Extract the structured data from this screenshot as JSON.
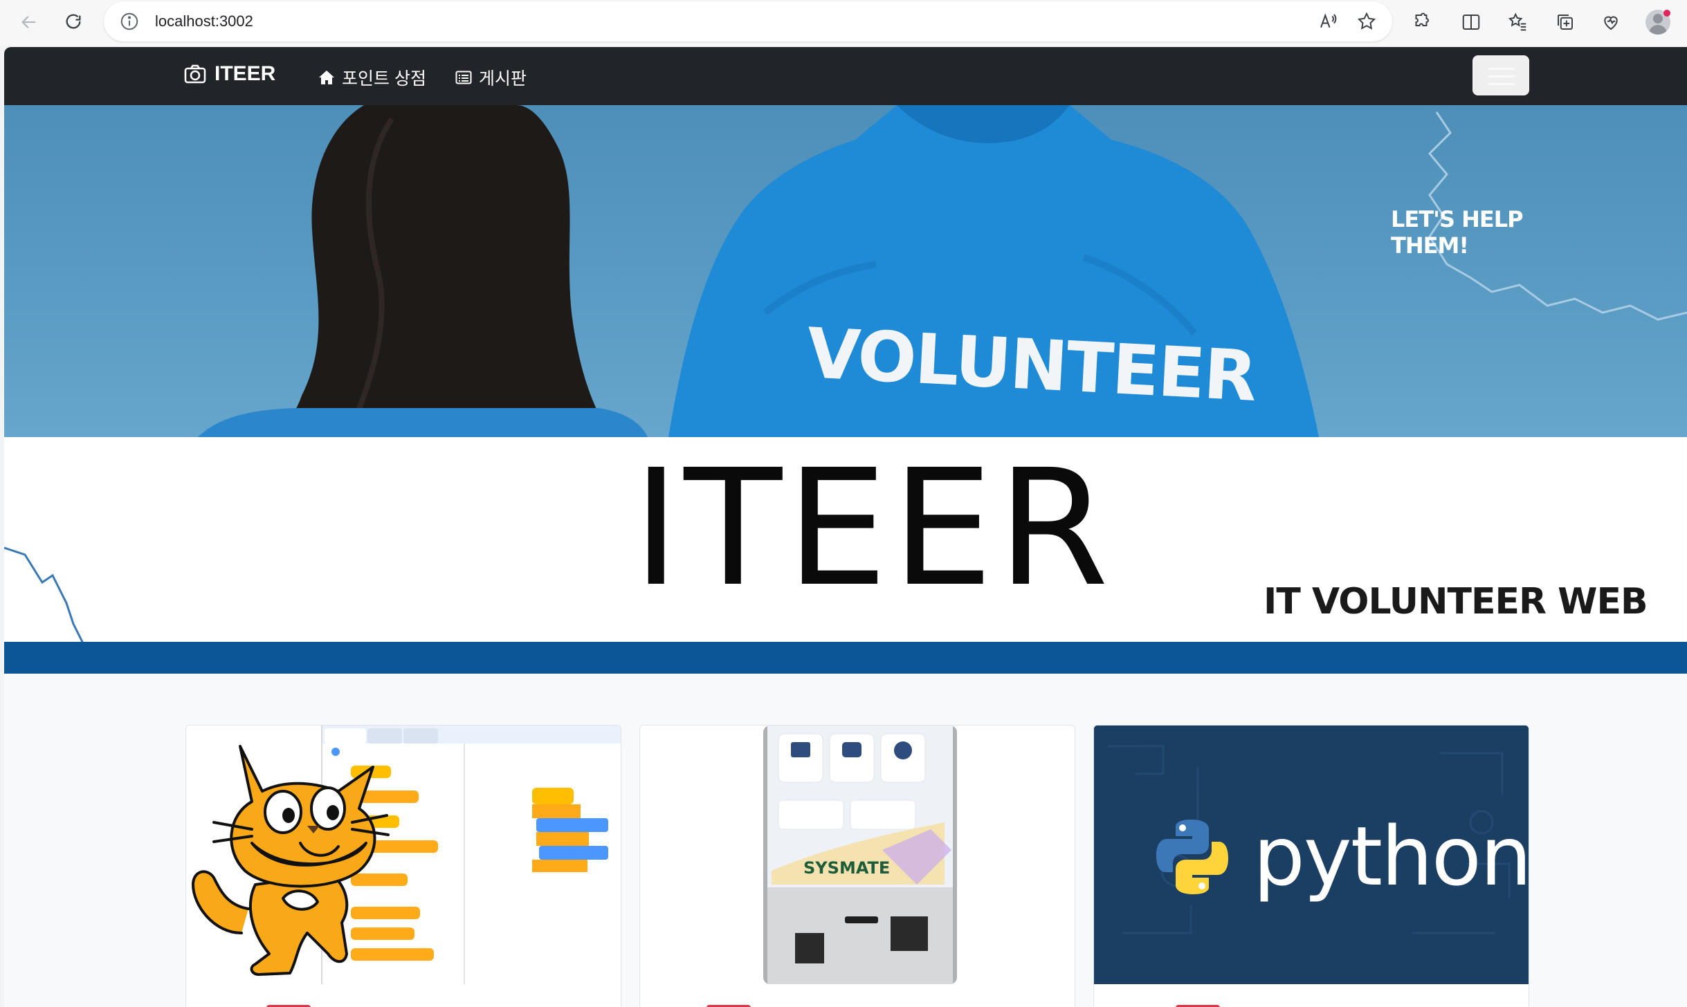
{
  "browser": {
    "url": "localhost:3002"
  },
  "navbar": {
    "brand": "ITEER",
    "links": [
      {
        "label": "포인트 상점",
        "icon": "home-icon"
      },
      {
        "label": "게시판",
        "icon": "list-alt-icon"
      }
    ]
  },
  "hero": {
    "shirt_text": "VOLUNTEER",
    "tagline": "LET'S HELP THEM!",
    "title": "ITEER",
    "subtitle": "IT VOLUNTEER WEB"
  },
  "cards": [
    {
      "image": "scratch-coding-thumbnail"
    },
    {
      "image": "sysmate-kiosk-thumbnail",
      "kiosk_brand": "SYSMATE"
    },
    {
      "image": "python-thumbnail",
      "word": "python"
    }
  ],
  "colors": {
    "navbar": "#212529",
    "hero_band": "#0c5697",
    "badge": "#dc3545",
    "python_bg": "#1b3e63"
  }
}
